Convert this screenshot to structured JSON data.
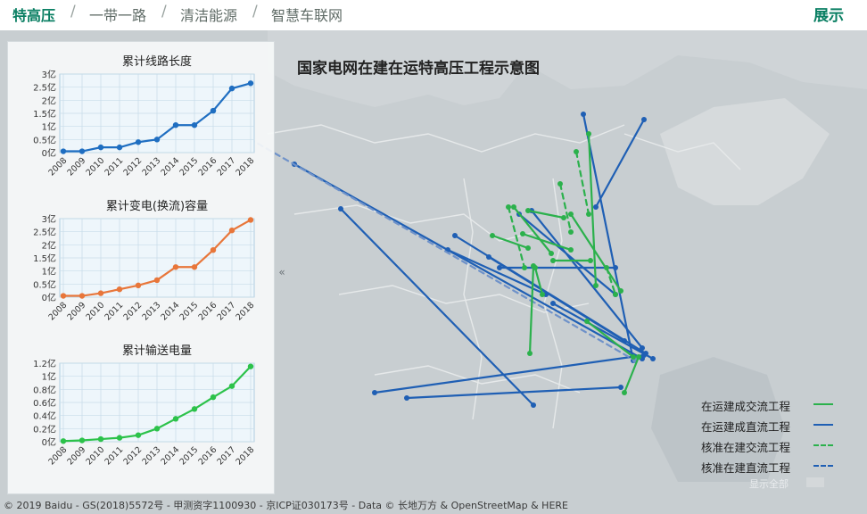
{
  "tabs": [
    {
      "label": "特高压",
      "active": true
    },
    {
      "label": "一带一路",
      "active": false
    },
    {
      "label": "清洁能源",
      "active": false
    },
    {
      "label": "智慧车联网",
      "active": false
    }
  ],
  "separator": "/",
  "show_button": "展示",
  "collapse_icon": "«",
  "map_title": "国家电网在建在运特高压工程示意图",
  "legend": [
    {
      "label": "在运建成交流工程",
      "color": "#2bb14c",
      "style": "solid"
    },
    {
      "label": "在运建成直流工程",
      "color": "#1f5fb4",
      "style": "solid"
    },
    {
      "label": "核准在建交流工程",
      "color": "#2bb14c",
      "style": "dashed"
    },
    {
      "label": "核准在建直流工程",
      "color": "#1f5fb4",
      "style": "dashed"
    }
  ],
  "show_all": "显示全部",
  "copyright": "© 2019 Baidu - GS(2018)5572号 - 甲测资字1100930 - 京ICP证030173号 - Data © 长地万方 & OpenStreetMap & HERE",
  "chart_data": [
    {
      "type": "line",
      "title": "累计线路长度",
      "categories": [
        "2008",
        "2009",
        "2010",
        "2011",
        "2012",
        "2013",
        "2014",
        "2015",
        "2016",
        "2017",
        "2018"
      ],
      "values": [
        0.05,
        0.05,
        0.2,
        0.2,
        0.4,
        0.5,
        1.05,
        1.05,
        1.6,
        2.45,
        2.65
      ],
      "ylim": [
        0,
        3
      ],
      "yticks": [
        "0亿",
        "0.5亿",
        "1亿",
        "1.5亿",
        "2亿",
        "2.5亿",
        "3亿"
      ],
      "color": "#1f6ec1",
      "grid": true
    },
    {
      "type": "line",
      "title": "累计变电(换流)容量",
      "categories": [
        "2008",
        "2009",
        "2010",
        "2011",
        "2012",
        "2013",
        "2014",
        "2015",
        "2016",
        "2017",
        "2018"
      ],
      "values": [
        0.05,
        0.05,
        0.15,
        0.3,
        0.45,
        0.65,
        1.15,
        1.15,
        1.8,
        2.55,
        2.95
      ],
      "ylim": [
        0,
        3
      ],
      "yticks": [
        "0亿",
        "0.5亿",
        "1亿",
        "1.5亿",
        "2亿",
        "2.5亿",
        "3亿"
      ],
      "color": "#e8763a",
      "grid": true
    },
    {
      "type": "line",
      "title": "累计输送电量",
      "categories": [
        "2008",
        "2009",
        "2010",
        "2011",
        "2012",
        "2013",
        "2014",
        "2015",
        "2016",
        "2017",
        "2018"
      ],
      "values": [
        0.01,
        0.02,
        0.04,
        0.06,
        0.1,
        0.2,
        0.35,
        0.5,
        0.68,
        0.85,
        1.15
      ],
      "ylim": [
        0,
        1.2
      ],
      "yticks": [
        "0亿",
        "0.2亿",
        "0.4亿",
        "0.6亿",
        "0.8亿",
        "1亿",
        "1.2亿"
      ],
      "color": "#2cc24a",
      "grid": true
    }
  ]
}
